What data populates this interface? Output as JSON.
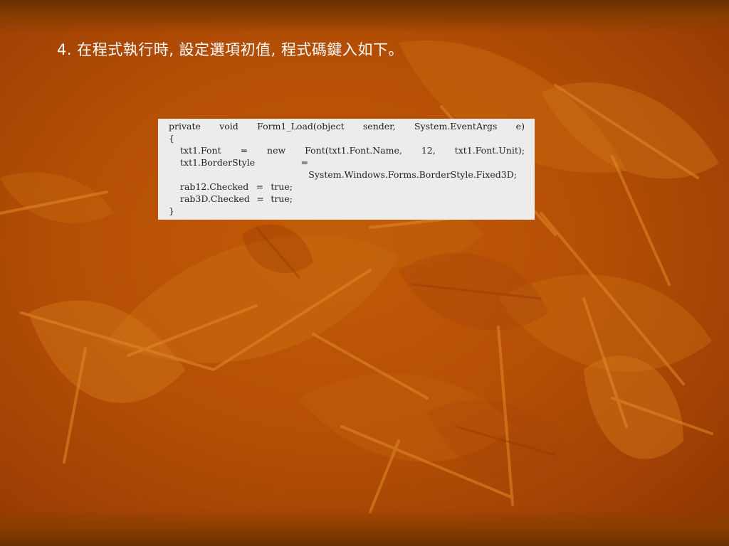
{
  "slide": {
    "title": "4. 在程式執行時, 設定選項初值, 程式碼鍵入如下。"
  },
  "code": {
    "line1": [
      "private",
      "void",
      "Form1_Load(object",
      "sender,",
      "System.EventArgs",
      "e)"
    ],
    "line2": "{",
    "line3": [
      "txt1.Font",
      "=",
      "new",
      "Font(txt1.Font.Name,",
      "12,",
      "txt1.Font.Unit);"
    ],
    "line4": [
      "txt1.BorderStyle",
      "="
    ],
    "line5": "System.Windows.Forms.BorderStyle.Fixed3D;",
    "line6": [
      "rab12.Checked",
      "=",
      "true;"
    ],
    "line7": [
      "rab3D.Checked",
      "=",
      "true;"
    ],
    "line8": "}"
  },
  "colors": {
    "background": "#b54f05",
    "leaf_light": "#d4771a",
    "leaf_dark": "#9a3a03",
    "code_box": "#ececec",
    "title_text": "#ffffff"
  }
}
